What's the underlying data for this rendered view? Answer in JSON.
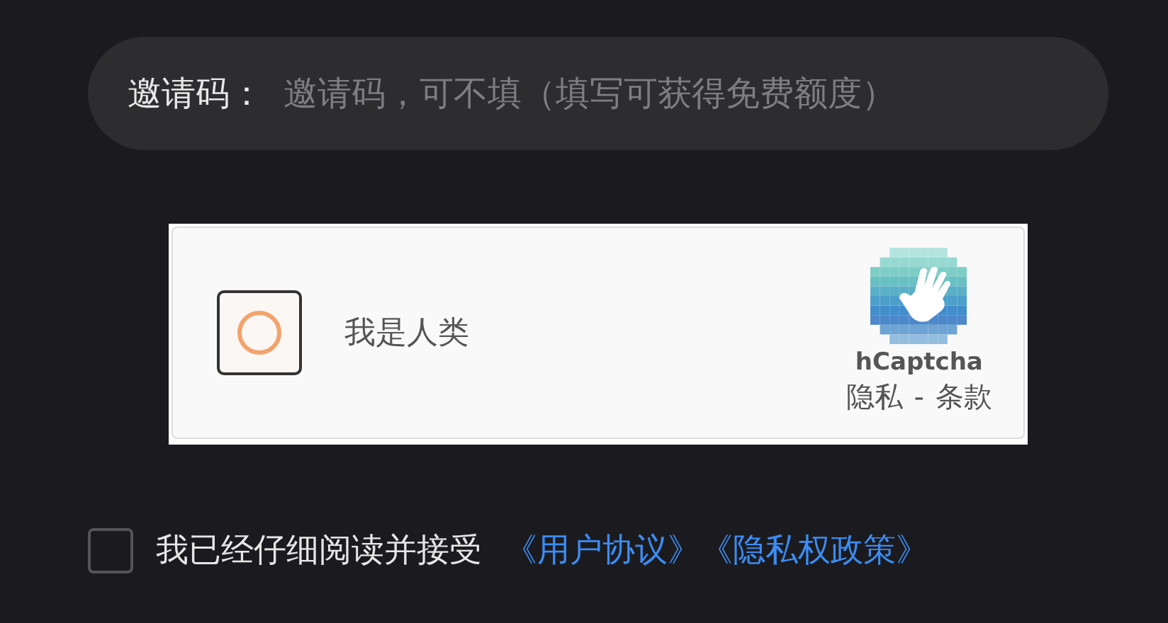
{
  "invite_code": {
    "label": "邀请码：",
    "placeholder": "邀请码，可不填（填写可获得免费额度）"
  },
  "captcha": {
    "checked": false,
    "label": "我是人类",
    "brand": "hCaptcha",
    "links": [
      "隐私",
      "条款"
    ],
    "separator": "-"
  },
  "agreement": {
    "checked": false,
    "text": "我已经仔细阅读并接受",
    "links": [
      "《用户协议》",
      "《隐私权政策》"
    ]
  }
}
